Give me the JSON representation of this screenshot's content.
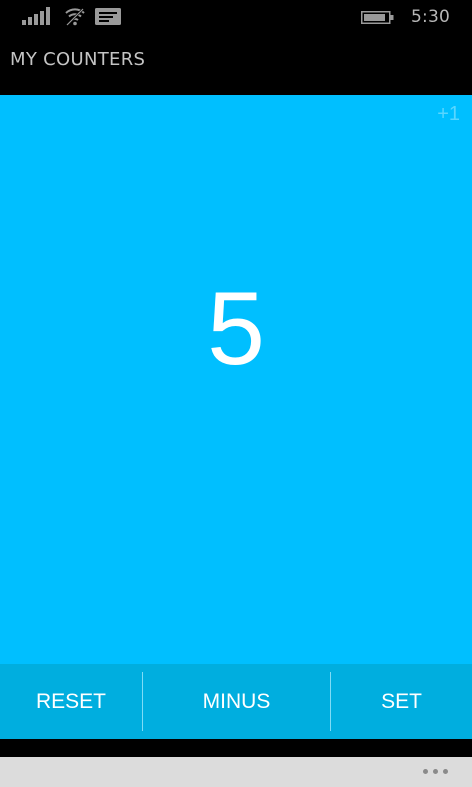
{
  "status_bar": {
    "time": "5:30",
    "icons": [
      "signal-icon",
      "wifi-icon",
      "message-icon",
      "battery-icon"
    ]
  },
  "app": {
    "title": "MY COUNTERS"
  },
  "counter": {
    "value": "5",
    "step_label": "+1",
    "background_color": "#00bfff"
  },
  "actions": {
    "reset_label": "RESET",
    "minus_label": "MINUS",
    "set_label": "SET"
  },
  "app_bar": {
    "more_icon": "more-icon"
  }
}
